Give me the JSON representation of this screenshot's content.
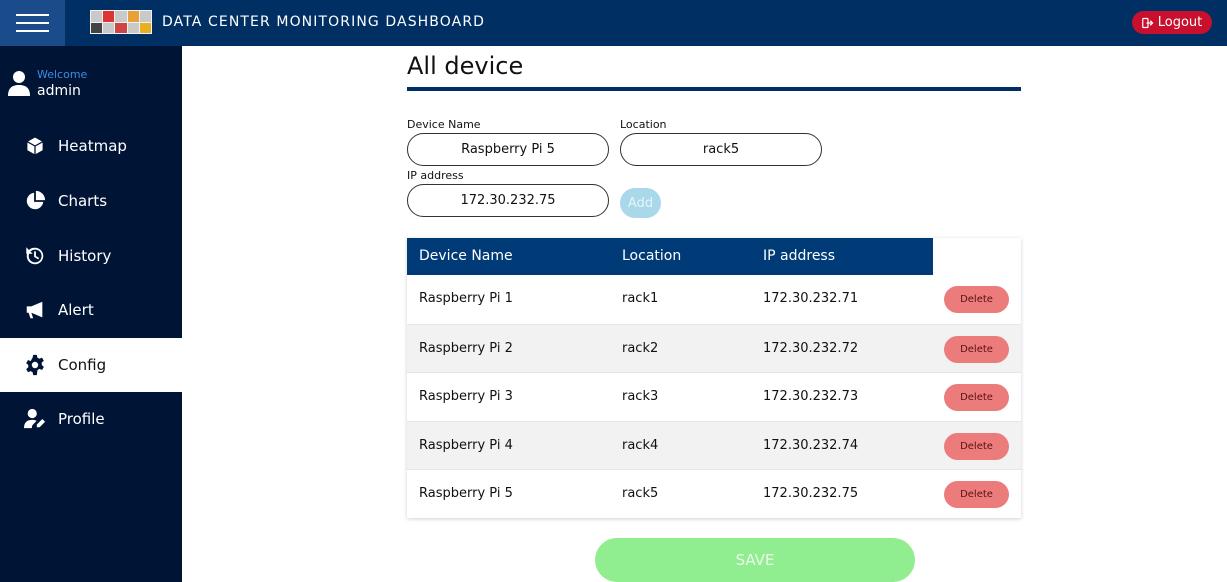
{
  "header": {
    "title": "DATA CENTER MONITORING DASHBOARD",
    "logout_label": "Logout",
    "menu_icon": "hamburger-icon",
    "logout_icon": "sign-out-icon"
  },
  "sidebar": {
    "welcome": "Welcome",
    "username": "admin",
    "items": [
      {
        "label": "Heatmap",
        "icon": "cube-icon",
        "active": false
      },
      {
        "label": "Charts",
        "icon": "pie-chart-icon",
        "active": false
      },
      {
        "label": "History",
        "icon": "history-icon",
        "active": false
      },
      {
        "label": "Alert",
        "icon": "bullhorn-icon",
        "active": false
      },
      {
        "label": "Config",
        "icon": "gear-icon",
        "active": true
      },
      {
        "label": "Profile",
        "icon": "user-edit-icon",
        "active": false
      }
    ]
  },
  "main": {
    "title": "All device",
    "form": {
      "device_name_label": "Device Name",
      "device_name_value": "Raspberry Pi 5",
      "location_label": "Location",
      "location_value": "rack5",
      "ip_label": "IP address",
      "ip_value": "172.30.232.75",
      "add_label": "Add"
    },
    "table": {
      "columns": [
        "Device Name",
        "Location",
        "IP address"
      ],
      "delete_label": "Delete",
      "rows": [
        {
          "name": "Raspberry Pi 1",
          "location": "rack1",
          "ip": "172.30.232.71"
        },
        {
          "name": "Raspberry Pi 2",
          "location": "rack2",
          "ip": "172.30.232.72"
        },
        {
          "name": "Raspberry Pi 3",
          "location": "rack3",
          "ip": "172.30.232.73"
        },
        {
          "name": "Raspberry Pi 4",
          "location": "rack4",
          "ip": "172.30.232.74"
        },
        {
          "name": "Raspberry Pi 5",
          "location": "rack5",
          "ip": "172.30.232.75"
        }
      ]
    },
    "save_label": "SAVE"
  },
  "colors": {
    "topbar": "#002f63",
    "sidebar": "#001535",
    "table_header": "#003b78",
    "logout": "#c8102e",
    "delete": "#ec7c7c",
    "save": "#90ee90",
    "add": "#a9d8ea"
  }
}
